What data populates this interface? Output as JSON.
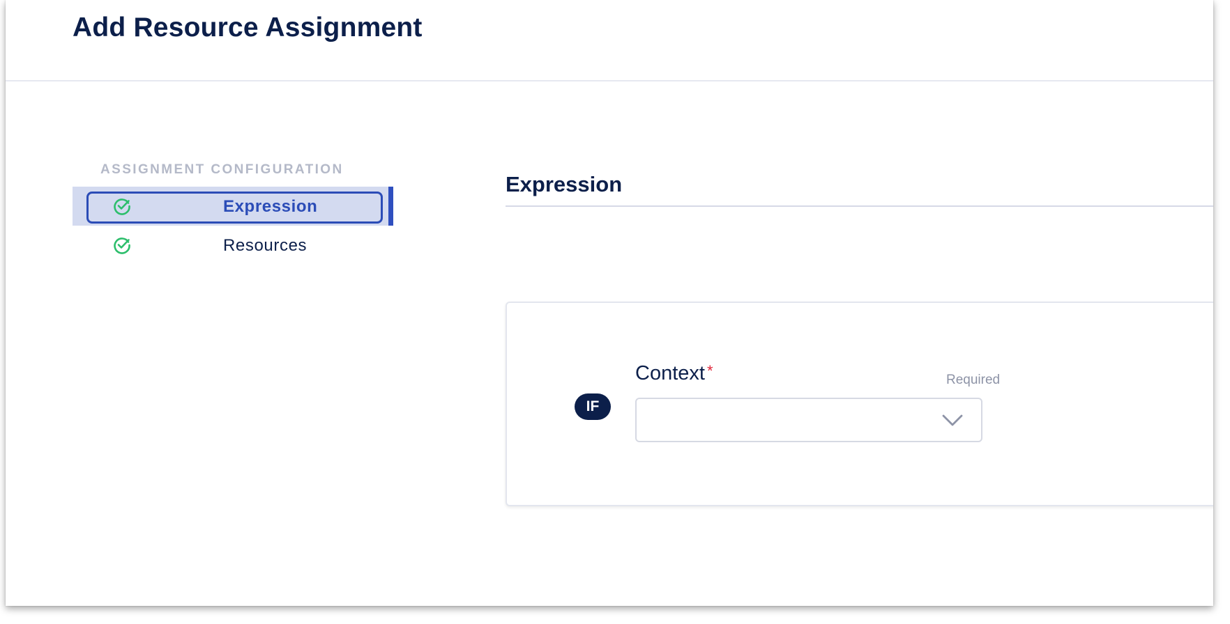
{
  "page": {
    "title": "Add Resource Assignment"
  },
  "sidebar": {
    "heading": "ASSIGNMENT CONFIGURATION",
    "items": [
      {
        "label": "Expression",
        "icon": "check-circle-icon",
        "active": true,
        "status": "complete"
      },
      {
        "label": "Resources",
        "icon": "check-circle-icon",
        "active": false,
        "status": "complete"
      }
    ]
  },
  "main": {
    "section_title": "Expression",
    "condition": {
      "badge": "IF",
      "context_field": {
        "label": "Context",
        "required_marker": "*",
        "hint": "Required",
        "value": "",
        "icon": "chevron-down-icon"
      }
    }
  },
  "colors": {
    "primary_text": "#0c1f4a",
    "accent": "#2b4cb7",
    "active_bg": "#d3daf0",
    "success": "#2dbe6c",
    "required": "#e0263a"
  }
}
